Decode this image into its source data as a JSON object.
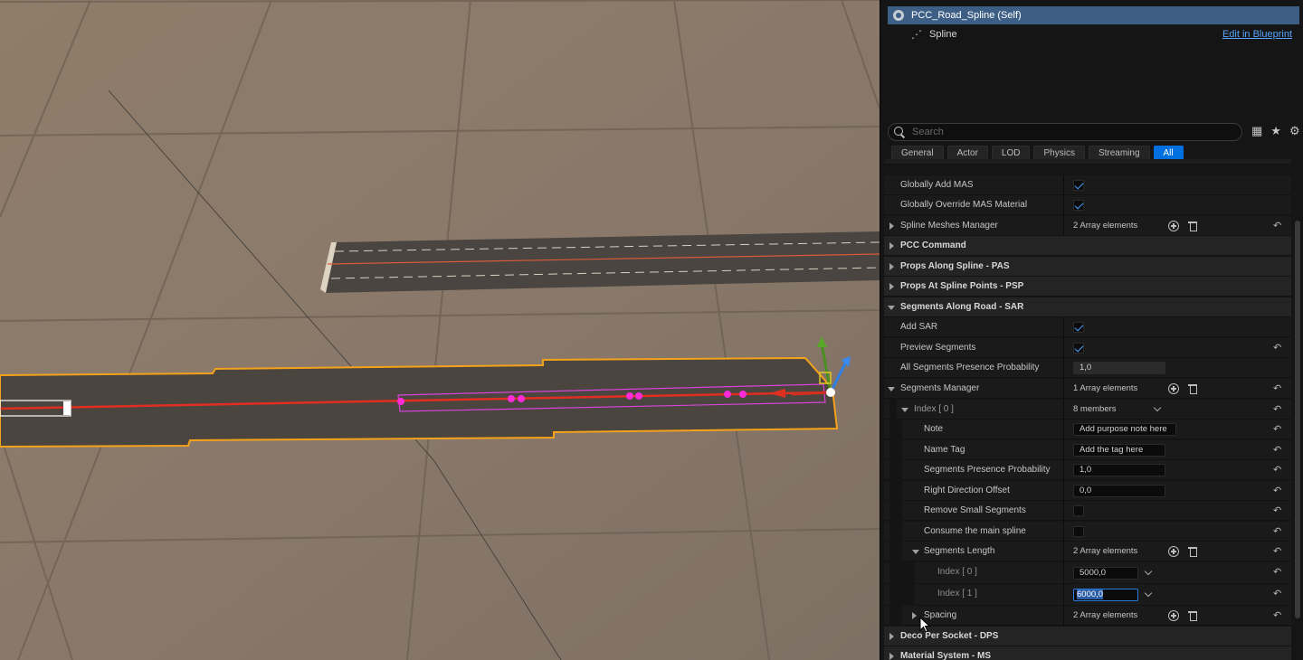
{
  "components": {
    "self": "PCC_Road_Spline (Self)",
    "child": "Spline",
    "edit_link": "Edit in Blueprint"
  },
  "search": {
    "placeholder": "Search"
  },
  "top_icons": [
    "table-view-icon",
    "star-icon",
    "settings-icon"
  ],
  "tabs": [
    "General",
    "Actor",
    "LOD",
    "Physics",
    "Streaming",
    "All"
  ],
  "active_tab": "All",
  "rows": [
    {
      "label": "Globally Add MAS",
      "kind": "check",
      "checked": true
    },
    {
      "label": "Globally Override MAS Material",
      "kind": "check",
      "checked": true
    },
    {
      "label": "Spline Meshes Manager",
      "kind": "array",
      "value": "2 Array elements"
    },
    {
      "label": "PCC Command",
      "kind": "cat"
    },
    {
      "label": "Props Along Spline - PAS",
      "kind": "cat"
    },
    {
      "label": "Props At Spline Points - PSP",
      "kind": "cat"
    },
    {
      "label": "Segments Along Road - SAR",
      "kind": "cat"
    },
    {
      "label": "Add SAR",
      "kind": "check",
      "checked": true
    },
    {
      "label": "Preview Segments",
      "kind": "check",
      "checked": true
    },
    {
      "label": "All Segments Presence Probability",
      "kind": "text",
      "value": "1,0"
    },
    {
      "label": "Segments Manager",
      "kind": "array",
      "value": "1 Array elements"
    },
    {
      "label": "Index [ 0 ]",
      "kind": "members",
      "value": "8 members"
    },
    {
      "label": "Note",
      "kind": "text",
      "value": "Add purpose note here"
    },
    {
      "label": "Name Tag",
      "kind": "text",
      "value": "Add the tag here"
    },
    {
      "label": "Segments Presence Probability",
      "kind": "text",
      "value": "1,0"
    },
    {
      "label": "Right Direction Offset",
      "kind": "text",
      "value": "0,0"
    },
    {
      "label": "Remove Small Segments",
      "kind": "check",
      "checked": false
    },
    {
      "label": "Consume the main spline",
      "kind": "check",
      "checked": false
    },
    {
      "label": "Segments Length",
      "kind": "array",
      "value": "2 Array elements"
    },
    {
      "label": "Index [ 0 ]",
      "kind": "num",
      "value": "5000,0"
    },
    {
      "label": "Index [ 1 ]",
      "kind": "num",
      "value": "6000,0"
    },
    {
      "label": "Spacing",
      "kind": "array",
      "value": "2 Array elements"
    },
    {
      "label": "Deco Per Socket - DPS",
      "kind": "cat"
    },
    {
      "label": "Material System - MS",
      "kind": "cat"
    }
  ]
}
